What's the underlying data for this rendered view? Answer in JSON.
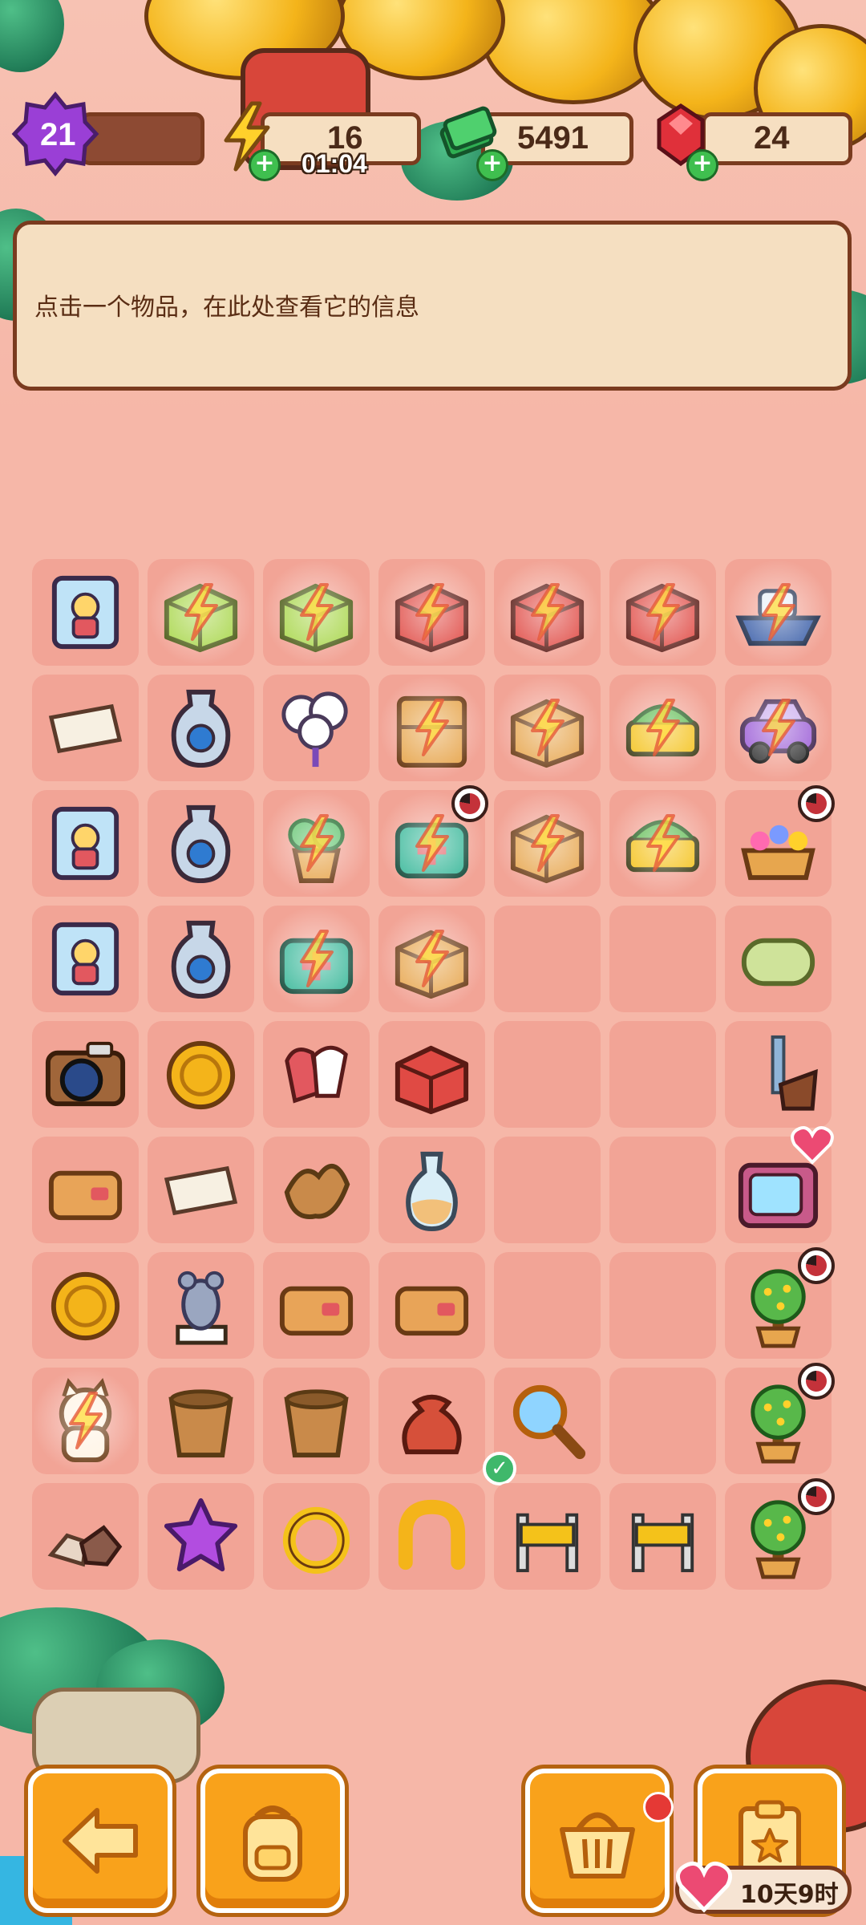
{
  "resources": {
    "level": "21",
    "energy": "16",
    "energy_timer": "01:04",
    "cash": "5491",
    "gems": "24"
  },
  "info_panel": {
    "text": "点击一个物品，在此处查看它的信息"
  },
  "board": {
    "rows": 9,
    "cols": 7,
    "items": [
      [
        "photo-card",
        "gift-box-green",
        "toolbox-green",
        "crate-white-red",
        "crate-red",
        "crate-red-big",
        "boat-blue"
      ],
      [
        "photo-paper",
        "vase-ornate",
        "balloon-bunch",
        "shelf-wood",
        "display-stand",
        "market-cart",
        "car-purple"
      ],
      [
        "photo-frame",
        "vase-jug",
        "plant-pot",
        "first-aid-kit",
        "wood-crate",
        "market-stall",
        "flower-cart"
      ],
      [
        "photo-small",
        "vase-round",
        "sewing-case",
        "cardboard-box",
        "",
        "",
        "soap-bar"
      ],
      [
        "camera",
        "pocket-watch-pair",
        "gloves",
        "red-toolbox",
        "",
        "",
        "cannon-post"
      ],
      [
        "photo-envelope",
        "paper-scrap",
        "leaf-cookie",
        "glass-vase",
        "",
        "",
        "tv-heart"
      ],
      [
        "gold-coin",
        "mouse-statue",
        "leather-wallet",
        "leather-pouch",
        "",
        "",
        "money-tree"
      ],
      [
        "lucky-cat",
        "wood-bucket",
        "broken-pot",
        "coin-pouch",
        "magnifier",
        "",
        "money-tree"
      ],
      [
        "rocks",
        "purple-star",
        "gold-ring",
        "gold-horseshoe",
        "road-barrier",
        "barrier-small",
        "money-tree"
      ]
    ],
    "generators": [
      [
        0,
        1
      ],
      [
        0,
        2
      ],
      [
        0,
        3
      ],
      [
        0,
        4
      ],
      [
        0,
        5
      ],
      [
        0,
        6
      ],
      [
        1,
        3
      ],
      [
        1,
        4
      ],
      [
        1,
        5
      ],
      [
        1,
        6
      ],
      [
        2,
        2
      ],
      [
        2,
        3
      ],
      [
        2,
        4
      ],
      [
        2,
        5
      ],
      [
        3,
        2
      ],
      [
        3,
        3
      ],
      [
        7,
        0
      ]
    ],
    "timer_badges": [
      [
        2,
        3
      ],
      [
        2,
        6
      ],
      [
        6,
        6
      ],
      [
        7,
        6
      ],
      [
        8,
        6
      ]
    ],
    "check_badges": [
      [
        7,
        4
      ]
    ],
    "heart_badges": [
      [
        5,
        6
      ]
    ]
  },
  "bottom_bar": {
    "back": "back-arrow-icon",
    "bag": "backpack-icon",
    "shop": "basket-icon",
    "tasks": "clipboard-star-icon",
    "event_timer": "10天9时"
  },
  "colors": {
    "background": "#f6b7a8",
    "cell": "#f2a496",
    "panel": "#f5dfc1",
    "border": "#7a3b1f",
    "button": "#f9a21b"
  }
}
